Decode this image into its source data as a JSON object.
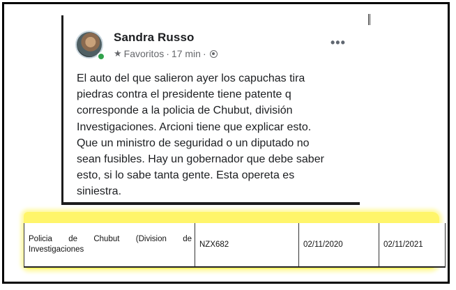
{
  "post": {
    "author": "Sandra Russo",
    "audience_label": "Favoritos",
    "time": "17 min",
    "separator": "·",
    "more_label": "•••",
    "body_lines": [
      "El auto del que salieron ayer los capuchas tira",
      "piedras contra el presidente tiene patente q",
      "corresponde a la policia de Chubut, división",
      "Investigaciones. Arcioni tiene que explicar esto.",
      "Que un ministro de seguridad o un diputado no",
      "sean fusibles. Hay un gobernador que debe saber",
      "esto, si lo sabe tanta gente. Esta opereta es",
      "siniestra."
    ],
    "icons": [
      "star-icon",
      "globe-icon",
      "more-icon"
    ],
    "status_color": "#31a24c"
  },
  "record": {
    "owner": "Policia de Chubut (Division de Investigaciones",
    "plate": "NZX682",
    "date_from": "02/11/2020",
    "date_to": "02/11/2021",
    "highlight_color": "#fff56a"
  }
}
